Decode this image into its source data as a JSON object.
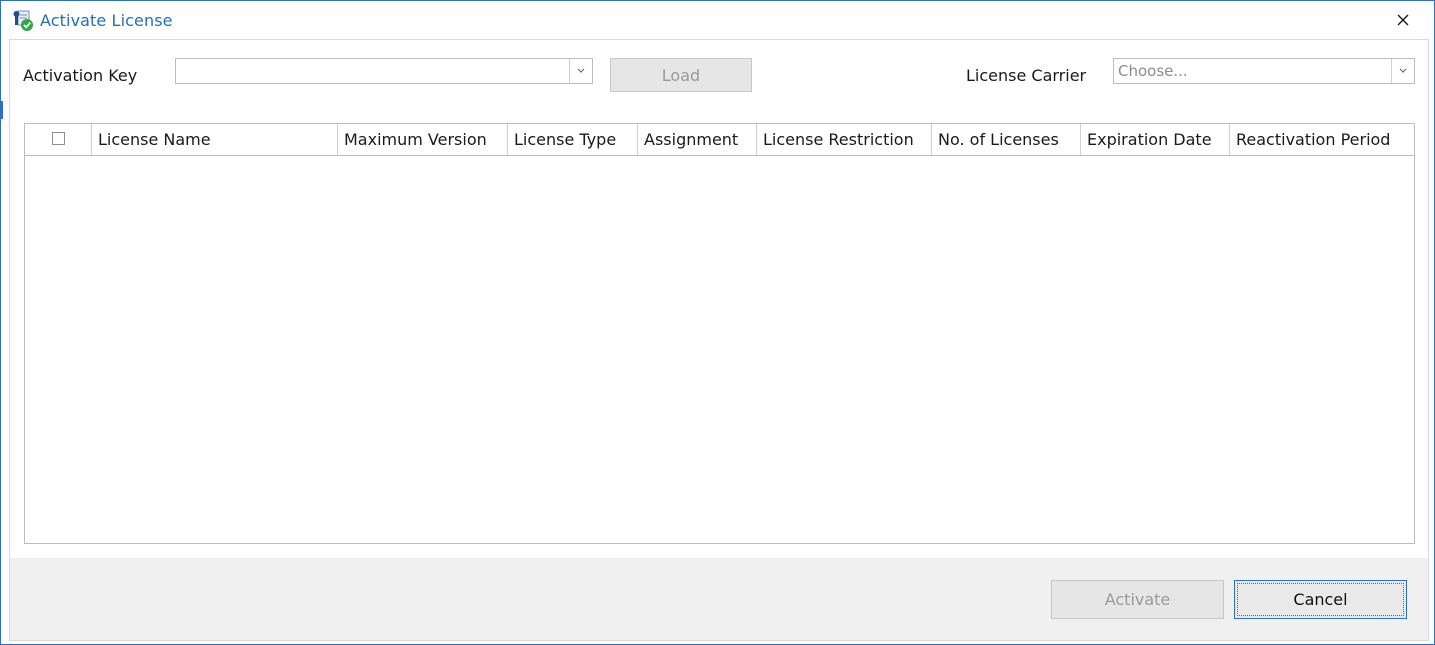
{
  "window": {
    "title": "Activate License",
    "icons": {
      "app": "license-activation-icon",
      "close": "close-icon"
    },
    "close_label": "×"
  },
  "form": {
    "activation_key_label": "Activation Key",
    "activation_key_value": "",
    "load_label": "Load",
    "license_carrier_label": "License Carrier",
    "license_carrier_placeholder": "Choose..."
  },
  "table": {
    "columns": [
      "License Name",
      "Maximum Version",
      "License Type",
      "Assignment",
      "License Restriction",
      "No. of Licenses",
      "Expiration Date",
      "Reactivation Period"
    ],
    "rows": []
  },
  "footer": {
    "activate_label": "Activate",
    "cancel_label": "Cancel"
  },
  "colors": {
    "accent": "#1f6fbd",
    "border": "#bdbdbd",
    "footer_bg": "#f0f0f0",
    "disabled_text": "#9a9a9a"
  }
}
